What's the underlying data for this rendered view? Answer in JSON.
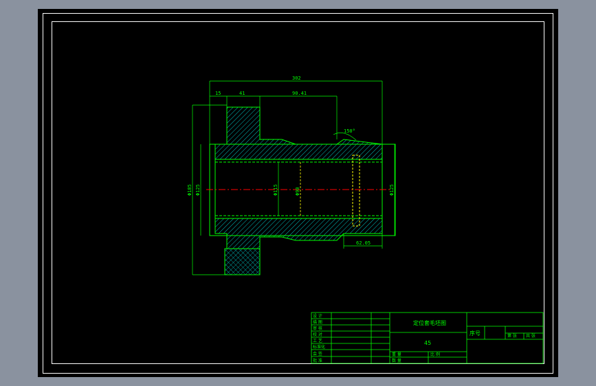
{
  "drawing": {
    "dimensions": {
      "overall_length": "302",
      "step_small": "15",
      "shoulder": "41",
      "recess": "90.41",
      "chamfer_angle": "150°",
      "end_length": "62.05",
      "dia_outer_left": "Φ185",
      "dia_left2": "Φ125",
      "dia_center1": "Φ115",
      "dia_center2": "Φ90",
      "dia_right": "Φ125"
    }
  },
  "title_block": {
    "part_name": "定位套毛坯图",
    "material": "45",
    "sequence_label": "序号",
    "sheet_label_1": "第 共",
    "sheet_label_2": "第 张",
    "sheet_label_3": "共 张",
    "rows_left": [
      "设 计",
      "描 图",
      "审 核",
      "校 对",
      "工 艺",
      "标准化",
      "会 签",
      "批 准"
    ],
    "bottom_labels": [
      "重 量",
      "比 例",
      "数 量"
    ]
  },
  "colors": {
    "background": "#000000",
    "line": "#00ff00",
    "frame": "#ffffff",
    "centerline": "#ff0000",
    "hatch": "#00c0c0",
    "dim_text": "#00ff00"
  }
}
